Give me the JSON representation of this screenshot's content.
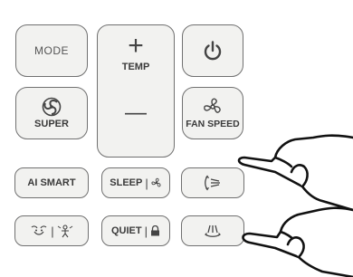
{
  "remote": {
    "mode_label": "MODE",
    "temp_label": "TEMP",
    "temp_plus": "+",
    "temp_minus": "—",
    "power_icon": "power-icon",
    "super_label": "SUPER",
    "super_icon": "fan-swirl-icon",
    "fan_speed_label": "FAN SPEED",
    "fan_speed_icon": "fan-blade-icon",
    "ai_smart_label": "AI SMART",
    "sleep_label": "SLEEP",
    "sleep_sep": "|",
    "sleep_icon": "sleep-fan-icon",
    "swing_icon": "vertical-swing-icon",
    "eco_sep": "|",
    "eco_icons": [
      "face-eco-icon",
      "person-wind-icon"
    ],
    "quiet_label": "QUIET",
    "quiet_sep": "|",
    "quiet_icon": "lock-icon",
    "horizontal_swing_icon": "horizontal-swing-icon",
    "pointer_icons": [
      "pointing-hand-icon",
      "pointing-hand-icon"
    ]
  },
  "colors": {
    "button_fill": "#f2f2f0",
    "button_border": "#707070",
    "text": "#3a3a3a",
    "background": "#ffffff"
  }
}
